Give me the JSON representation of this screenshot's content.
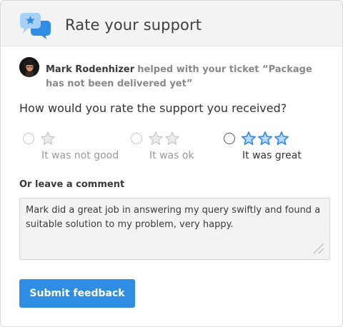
{
  "header": {
    "title": "Rate your support"
  },
  "agent": {
    "name": "Mark Rodenhizer",
    "message": "helped with your ticket “Package has not been delivered yet”"
  },
  "question": "How would you rate the support you received?",
  "rating_options": [
    {
      "label": "It was not good",
      "stars": 1,
      "selected": false
    },
    {
      "label": "It was ok",
      "stars": 2,
      "selected": false
    },
    {
      "label": "It was great",
      "stars": 3,
      "selected": false
    }
  ],
  "comment": {
    "heading": "Or leave a comment",
    "value": "Mark did a great job in answering my query swiftly and found a suitable solution to my problem, very happy."
  },
  "submit_label": "Submit feedback",
  "colors": {
    "accent": "#2f8de4",
    "star_active": "#2f8de4",
    "star_inactive": "#c9c9c9"
  },
  "icons": [
    "chat-bubbles-star-icon",
    "star-icon",
    "resize-grip-icon"
  ]
}
